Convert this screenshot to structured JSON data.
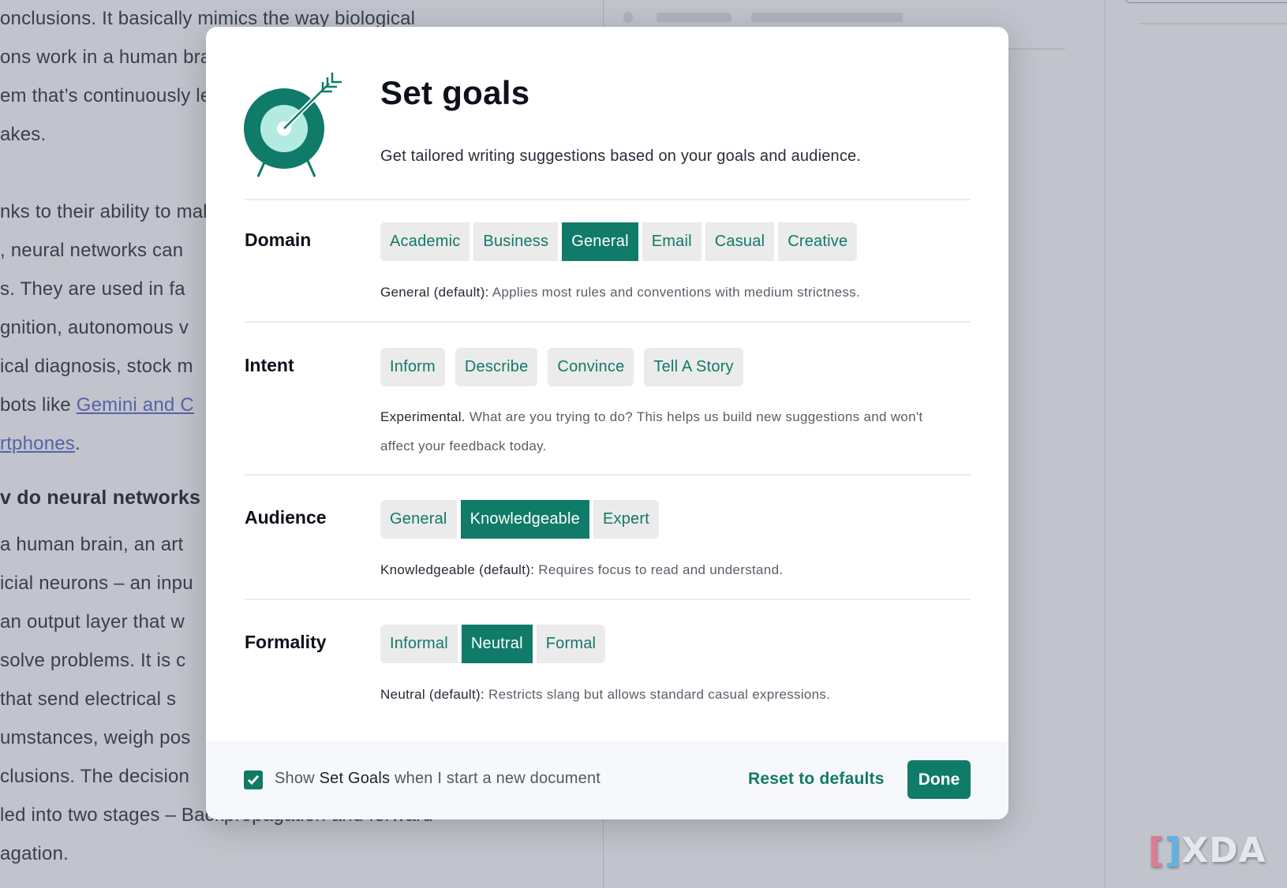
{
  "background_document": {
    "lines": [
      "onclusions. It basically mimics the way biological",
      "ons work in a human brain. It works through a",
      "em that’s continuously learning from its",
      "akes.",
      "",
      "nks to their ability to make",
      ", neural networks can",
      "s. They are used in fa",
      "gnition, autonomous v",
      "ical diagnosis, stock m",
      "bots like ",
      "rtphones"
    ],
    "link_1": "Gemini and C",
    "link_2": "rtphones",
    "link_2_suffix": ".",
    "heading": "v do neural networks",
    "lines_2": [
      " a human brain, an art",
      "icial neurons – an inpu",
      "an output layer that w",
      "solve problems. It is c",
      " that send electrical s",
      "umstances, weigh pos",
      "clusions. The decision",
      "led into two stages – Backpropagation and forward",
      "agation."
    ]
  },
  "watermark": {
    "bracket_left": "[",
    "bracket_right": "]",
    "text": "XDA"
  },
  "modal": {
    "title": "Set goals",
    "subtitle": "Get tailored writing suggestions based on your goals and audience.",
    "sections": {
      "domain": {
        "label": "Domain",
        "options": [
          "Academic",
          "Business",
          "General",
          "Email",
          "Casual",
          "Creative"
        ],
        "selected": "General",
        "desc_lead": "General (default):",
        "desc_text": " Applies most rules and conventions with medium strictness."
      },
      "intent": {
        "label": "Intent",
        "options": [
          "Inform",
          "Describe",
          "Convince",
          "Tell A Story"
        ],
        "selected": null,
        "desc_lead": "Experimental.",
        "desc_text": " What are you trying to do? This helps us build new suggestions and won't affect your feedback today."
      },
      "audience": {
        "label": "Audience",
        "options": [
          "General",
          "Knowledgeable",
          "Expert"
        ],
        "selected": "Knowledgeable",
        "desc_lead": "Knowledgeable (default):",
        "desc_text": " Requires focus to read and understand."
      },
      "formality": {
        "label": "Formality",
        "options": [
          "Informal",
          "Neutral",
          "Formal"
        ],
        "selected": "Neutral",
        "desc_lead": "Neutral (default):",
        "desc_text": " Restricts slang but allows standard casual expressions."
      }
    },
    "footer": {
      "checkbox_checked": true,
      "checkbox_prefix": "Show ",
      "checkbox_emphasis": "Set Goals",
      "checkbox_suffix": " when I start a new document",
      "reset_label": "Reset to defaults",
      "done_label": "Done"
    }
  },
  "colors": {
    "accent": "#0f7b68",
    "accent_light": "#b3ebe3",
    "pill_bg": "#ebebeb",
    "overlay": "#c1c4cc"
  }
}
